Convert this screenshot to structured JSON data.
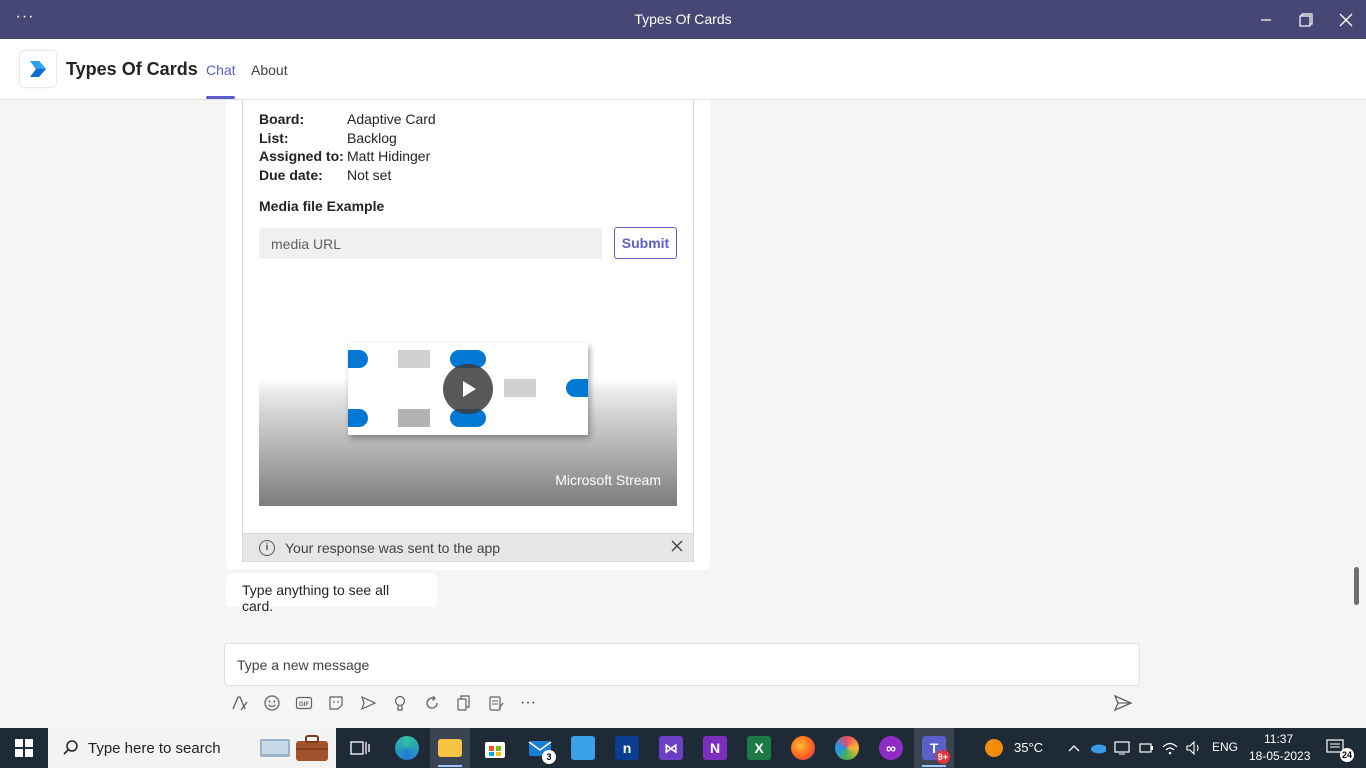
{
  "window": {
    "title": "Types Of Cards",
    "more_label": "···"
  },
  "app": {
    "name": "Types Of Cards",
    "tabs": [
      {
        "label": "Chat",
        "active": true
      },
      {
        "label": "About",
        "active": false
      }
    ],
    "accent_color": "#5b5fc7",
    "titlebar_color": "#464775"
  },
  "card": {
    "facts": [
      {
        "key": "Board:",
        "value": "Adaptive Card"
      },
      {
        "key": "List:",
        "value": "Backlog"
      },
      {
        "key": "Assigned to:",
        "value": "Matt Hidinger"
      },
      {
        "key": "Due date:",
        "value": "Not set"
      }
    ],
    "section_title": "Media file Example",
    "media_input_placeholder": "media URL",
    "submit_label": "Submit",
    "video_label": "Microsoft Stream",
    "notice_text": "Your response was sent to the app"
  },
  "messages": [
    {
      "text": "Type anything to see all card."
    }
  ],
  "compose": {
    "placeholder": "Type a new message",
    "toolbar_icons": [
      "format-icon",
      "emoji-icon",
      "gif-icon",
      "sticker-icon",
      "meet-icon",
      "praise-icon",
      "loop-icon",
      "copy-icon",
      "approvals-icon",
      "more-icon"
    ],
    "more_label": "···"
  },
  "taskbar": {
    "search_placeholder": "Type here to search",
    "mail_badge": "3",
    "teams_badge": "9+",
    "weather": "35°C",
    "language": "ENG",
    "time": "11:37",
    "date": "18-05-2023",
    "notification_count": "24"
  }
}
